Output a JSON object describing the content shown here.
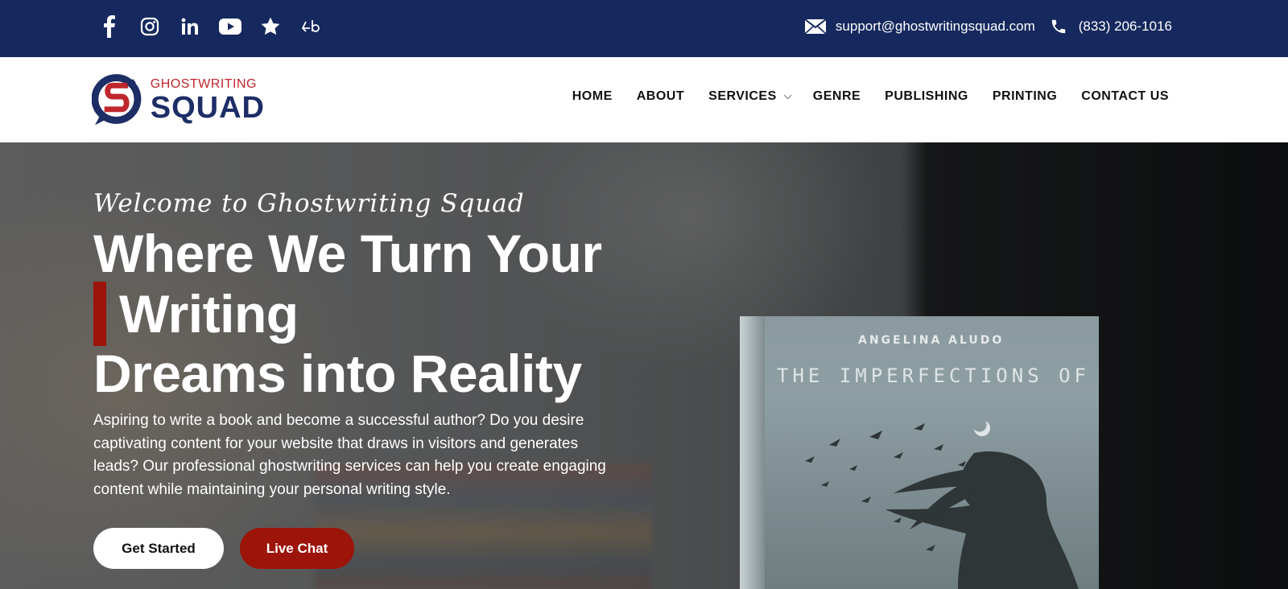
{
  "topbar": {
    "social_icons": [
      "facebook-icon",
      "instagram-icon",
      "linkedin-icon",
      "youtube-icon",
      "star-icon",
      "goodreads-icon"
    ],
    "email": "support@ghostwritingsquad.com",
    "phone": "(833) 206-1016"
  },
  "header": {
    "logo": {
      "top": "GHOSTWRITING",
      "bottom": "SQUAD"
    },
    "nav": [
      {
        "label": "HOME"
      },
      {
        "label": "ABOUT"
      },
      {
        "label": "SERVICES",
        "has_dropdown": true
      },
      {
        "label": "GENRE"
      },
      {
        "label": "PUBLISHING"
      },
      {
        "label": "PRINTING"
      },
      {
        "label": "CONTACT US"
      }
    ]
  },
  "hero": {
    "welcome": "Welcome to Ghostwriting Squad",
    "headline_line1": "Where We Turn Your",
    "headline_line2": "Writing",
    "headline_line3": "Dreams into Reality",
    "description": "Aspiring to write a book and become a successful author? Do you desire captivating content for your website that draws in visitors and generates leads? Our professional ghostwriting services can help you create engaging content while maintaining your personal writing style.",
    "primary_button": "Get Started",
    "secondary_button": "Live Chat",
    "book": {
      "author": "ANGELINA ALUDO",
      "title": "THE IMPERFECTIONS OF"
    }
  },
  "colors": {
    "topbar_bg": "#16295e",
    "accent_red": "#9c140a",
    "logo_red": "#c0262d",
    "logo_navy": "#1d2d66"
  }
}
